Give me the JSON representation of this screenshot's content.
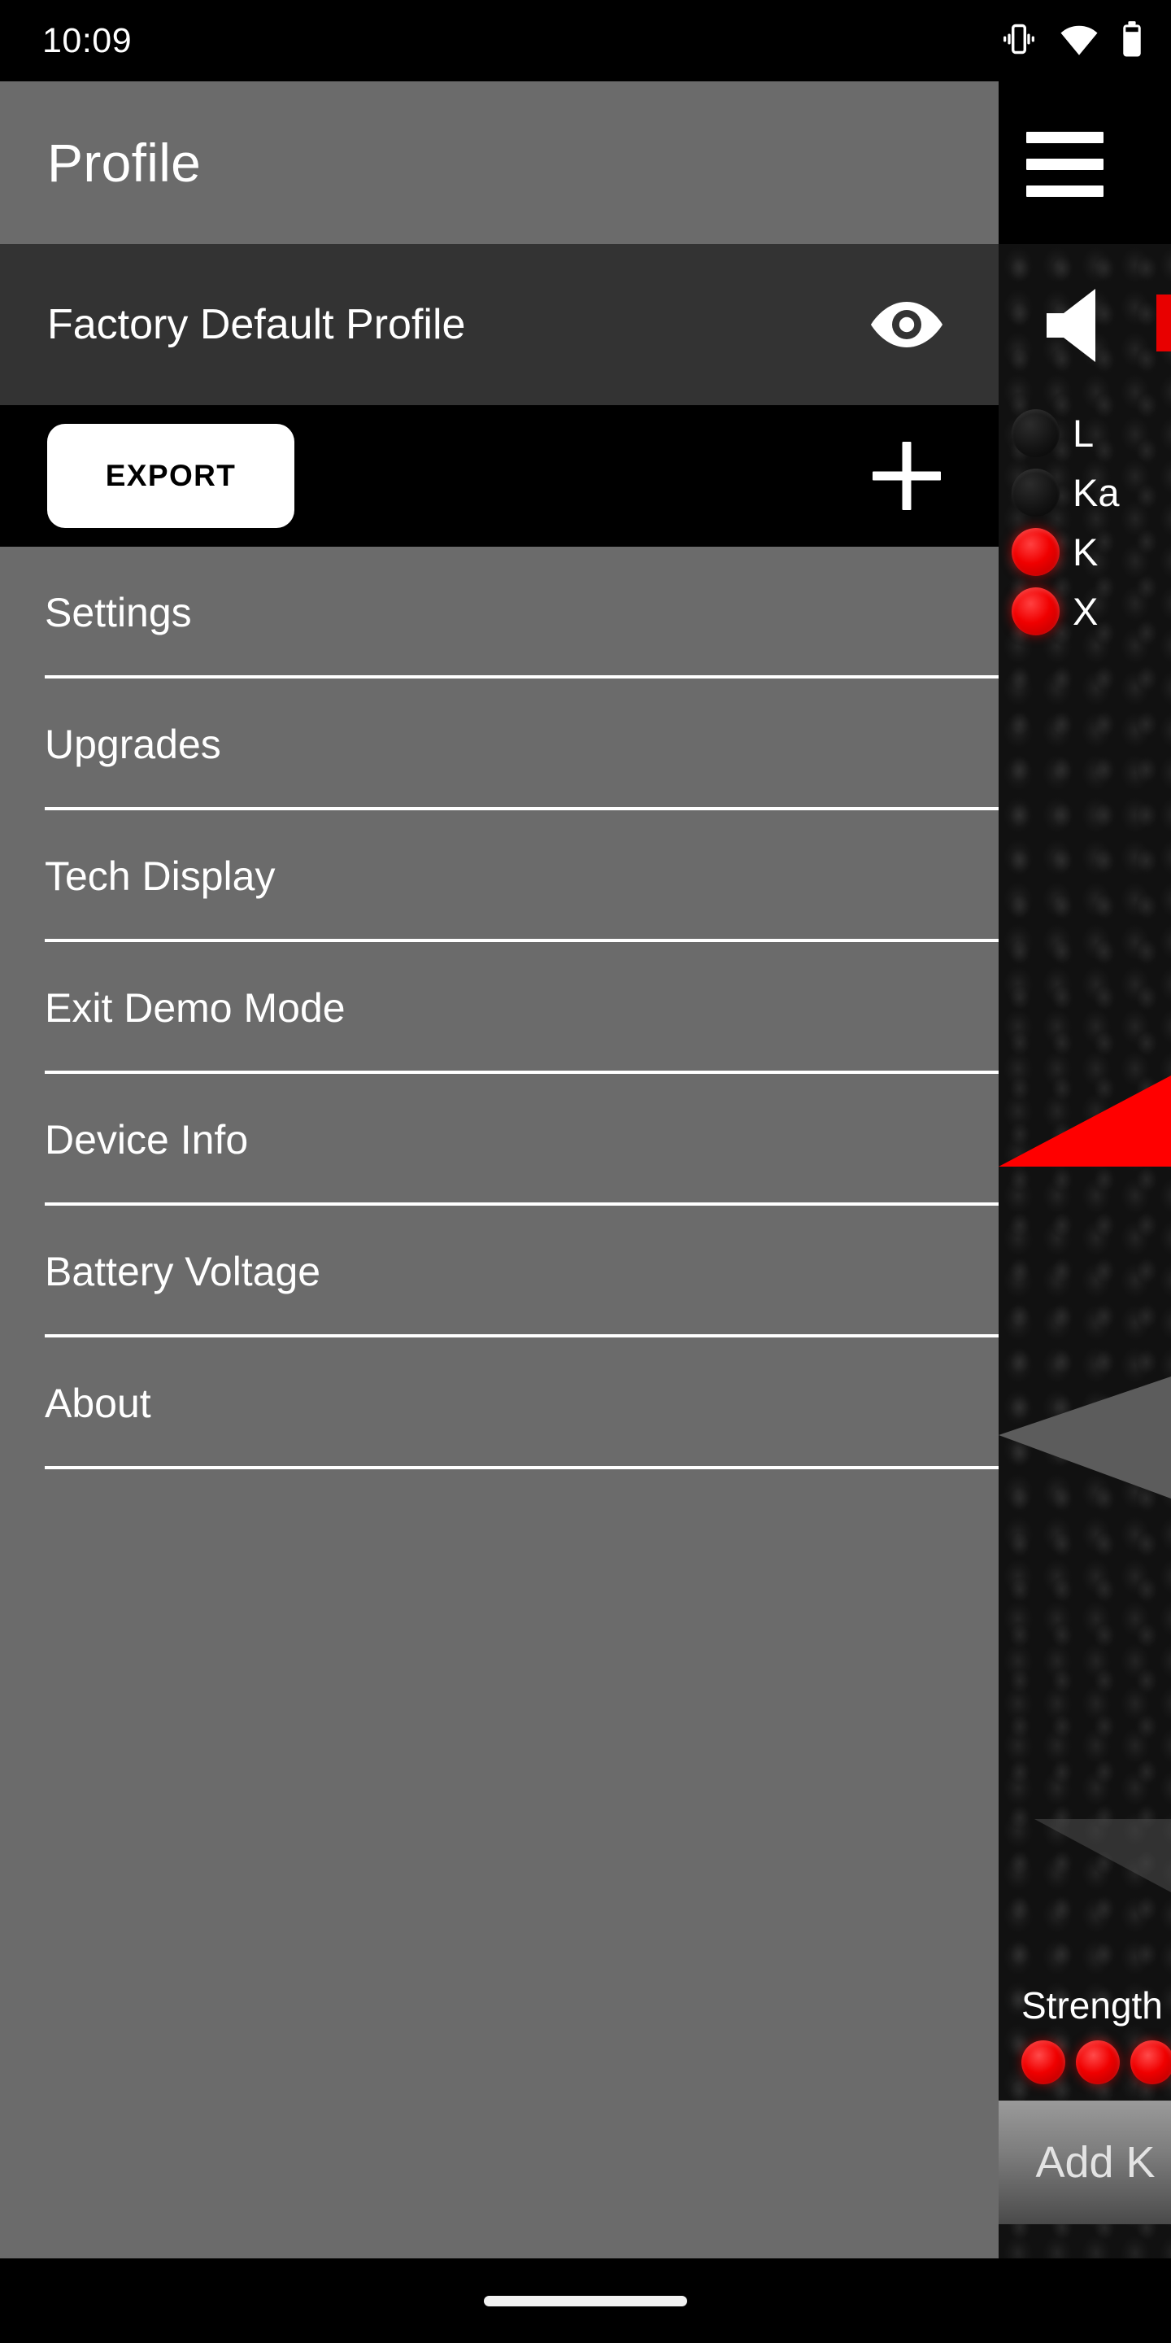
{
  "status_bar": {
    "time": "10:09",
    "icons": [
      "vibrate-icon",
      "wifi-icon",
      "battery-icon"
    ]
  },
  "app_bar": {
    "title": "Profile",
    "menu_icon": "hamburger-menu-icon"
  },
  "profile_row": {
    "name": "Factory Default Profile",
    "visibility_icon": "eye-icon"
  },
  "action_bar": {
    "export_label": "EXPORT",
    "add_icon": "plus-icon"
  },
  "menu": {
    "items": [
      {
        "label": "Settings"
      },
      {
        "label": "Upgrades"
      },
      {
        "label": "Tech Display"
      },
      {
        "label": "Exit Demo Mode"
      },
      {
        "label": "Device Info"
      },
      {
        "label": "Battery Voltage"
      },
      {
        "label": "About"
      }
    ]
  },
  "detector_panel": {
    "mute_icon": "speaker-icon",
    "bands": [
      {
        "label": "L",
        "lit": false
      },
      {
        "label": "Ka",
        "lit": false
      },
      {
        "label": "K",
        "lit": true
      },
      {
        "label": "X",
        "lit": true
      }
    ],
    "arrows": [
      {
        "name": "front-arrow",
        "color": "#ff0000",
        "lit": true
      },
      {
        "name": "rear-arrow",
        "color": "#555555",
        "lit": false
      }
    ],
    "strength_label": "Strength",
    "strength_dots": 3,
    "strength_dot_color": "#ff0000",
    "add_button_label": "Add K"
  },
  "nav_bar": {
    "handle": "gesture-home-handle"
  },
  "colors": {
    "app_bar_bg": "#6b6b6b",
    "profile_row_bg": "#333333",
    "action_bar_bg": "#000000",
    "list_bg": "#6b6b6b",
    "accent_red": "#ff0000",
    "export_bg": "#ffffff"
  }
}
